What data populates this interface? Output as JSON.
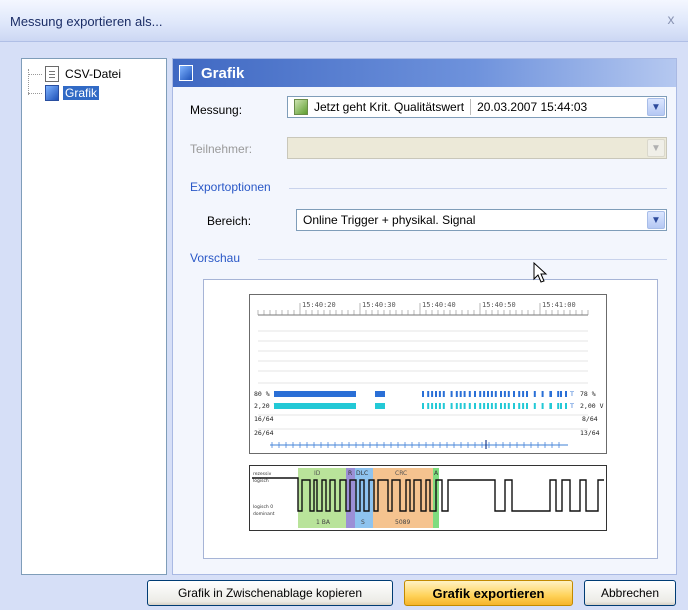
{
  "window": {
    "title": "Messung exportieren als..."
  },
  "tree": {
    "items": [
      {
        "label": "CSV-Datei",
        "icon": "csv-file-icon",
        "selected": false
      },
      {
        "label": "Grafik",
        "icon": "graphic-icon",
        "selected": true
      }
    ]
  },
  "panel": {
    "title": "Grafik",
    "messung": {
      "label": "Messung:",
      "name": "Jetzt geht Krit. Qualitätswert",
      "datetime": "20.03.2007 15:44:03"
    },
    "teilnehmer": {
      "label": "Teilnehmer:",
      "value": ""
    },
    "exportoptionen": {
      "title": "Exportoptionen",
      "bereich_label": "Bereich:",
      "bereich_value": "Online Trigger + physikal. Signal"
    },
    "vorschau": {
      "title": "Vorschau",
      "time_ticks": [
        "15:40:20",
        "15:40:30",
        "15:40:40",
        "15:40:50",
        "15:41:00"
      ],
      "left_labels": [
        "80 %",
        "2,20 V",
        "16/64",
        "26/64"
      ],
      "right_labels": [
        "78 %",
        "2,00 V",
        "8/64",
        "13/64"
      ],
      "right_markers": [
        "T",
        "T"
      ],
      "signal": {
        "left_labels": [
          "rezessiv",
          "logisch",
          "logisch 0",
          "dominant"
        ],
        "segments": [
          {
            "label": "ID",
            "value": "1 BA",
            "color": "#b9e39a"
          },
          {
            "label": "R",
            "value": "",
            "color": "#9b8fd6"
          },
          {
            "label": "DLC",
            "value": "S",
            "color": "#8ec3ef"
          },
          {
            "label": "CRC",
            "value": "5089",
            "color": "#f5c38f"
          },
          {
            "label": "A",
            "value": "",
            "color": "#7fdc7f"
          }
        ]
      }
    }
  },
  "buttons": {
    "copy": "Grafik in Zwischenablage kopieren",
    "export": "Grafik exportieren",
    "cancel": "Abbrechen"
  }
}
